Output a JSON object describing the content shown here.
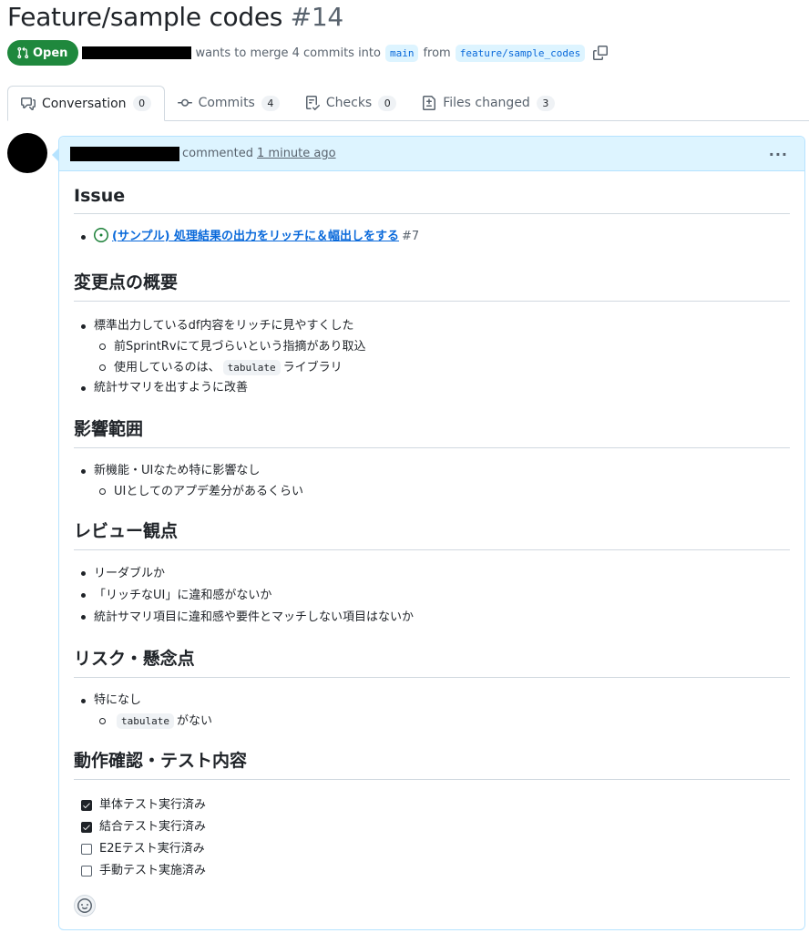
{
  "pr": {
    "title": "Feature/sample codes",
    "number": "#14",
    "state": "Open",
    "merge_text": "wants to merge 4 commits into",
    "base_branch": "main",
    "from_text": "from",
    "head_branch": "feature/sample_codes"
  },
  "tabs": [
    {
      "label": "Conversation",
      "count": "0",
      "icon": "conversation-icon"
    },
    {
      "label": "Commits",
      "count": "4",
      "icon": "commit-icon"
    },
    {
      "label": "Checks",
      "count": "0",
      "icon": "checklist-icon"
    },
    {
      "label": "Files changed",
      "count": "3",
      "icon": "file-diff-icon"
    }
  ],
  "comment": {
    "action": "commented",
    "time": "1 minute ago",
    "more_icon": "kebab-horizontal-icon",
    "sections": {
      "issue": {
        "heading": "Issue",
        "link_text": "(サンプル) 処理結果の出力をリッチに＆幅出しをする",
        "link_num": "#7"
      },
      "overview": {
        "heading": "変更点の概要",
        "item1": "標準出力しているdf内容をリッチに見やすくした",
        "item1_sub1": "前SprintRvにて見づらいという指摘があり取込",
        "item1_sub2_pre": "使用しているのは、",
        "item1_sub2_code": "tabulate",
        "item1_sub2_post": "ライブラリ",
        "item2": "統計サマリを出すように改善"
      },
      "impact": {
        "heading": "影響範囲",
        "item1": "新機能・UIなため特に影響なし",
        "item1_sub1": "UIとしてのアプデ差分があるくらい"
      },
      "review": {
        "heading": "レビュー観点",
        "items": [
          "リーダブルか",
          "「リッチなUI」に違和感がないか",
          "統計サマリ項目に違和感や要件とマッチしない項目はないか"
        ]
      },
      "risk": {
        "heading": "リスク・懸念点",
        "item1": "特になし",
        "item1_sub1_code": "tabulate",
        "item1_sub1_post": "がない"
      },
      "tests": {
        "heading": "動作確認・テスト内容",
        "tasks": [
          {
            "label": "単体テスト実行済み",
            "checked": true
          },
          {
            "label": "結合テスト実行済み",
            "checked": true
          },
          {
            "label": "E2Eテスト実行済み",
            "checked": false
          },
          {
            "label": "手動テスト実施済み",
            "checked": false
          }
        ]
      }
    },
    "reaction_icon": "smiley-icon"
  }
}
